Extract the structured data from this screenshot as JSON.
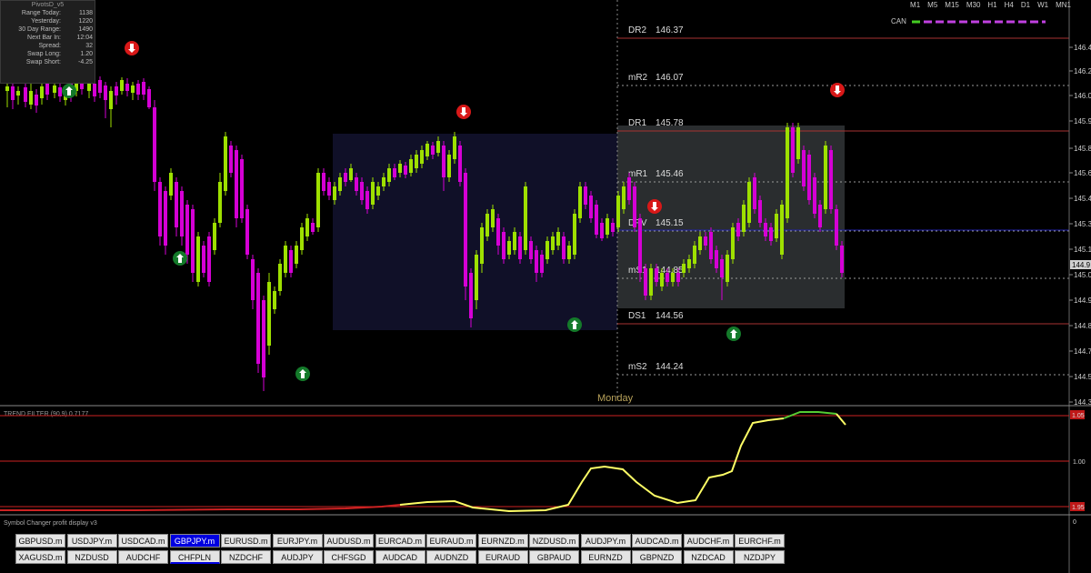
{
  "info_panel": {
    "title": "PivotsD_v5",
    "rows": [
      {
        "label": "Range  Today:",
        "value": "1138"
      },
      {
        "label": "Yesterday:",
        "value": "1220"
      },
      {
        "label": "30 Day Range:",
        "value": "1490"
      },
      {
        "label": "Next Bar In:",
        "value": "12:04"
      },
      {
        "label": "Spread:",
        "value": "32"
      },
      {
        "label": "Swap  Long:",
        "value": "1.20"
      },
      {
        "label": "Swap  Short:",
        "value": "-4.25"
      }
    ]
  },
  "timeframes": [
    "M1",
    "M5",
    "M15",
    "M30",
    "H1",
    "H4",
    "D1",
    "W1",
    "MN1"
  ],
  "legend_label": "CAN",
  "day_label": "Monday",
  "pivots": [
    {
      "name": "DR2",
      "value": "146.37",
      "price": 146.37
    },
    {
      "name": "mR2",
      "value": "146.07",
      "price": 146.07
    },
    {
      "name": "DR1",
      "value": "145.78",
      "price": 145.78
    },
    {
      "name": "mR1",
      "value": "145.46",
      "price": 145.46
    },
    {
      "name": "DPV",
      "value": "145.15",
      "price": 145.15
    },
    {
      "name": "mS1",
      "value": "144.85",
      "price": 144.85
    },
    {
      "name": "DS1",
      "value": "144.56",
      "price": 144.56
    },
    {
      "name": "mS2",
      "value": "144.24",
      "price": 144.24
    }
  ],
  "price_axis": [
    "146.4",
    "146.2",
    "146.0",
    "145.9",
    "145.8",
    "145.6",
    "145.4",
    "145.3",
    "145.1",
    "145.0",
    "144.9",
    "144.8",
    "144.7",
    "144.5",
    "144.3",
    "144.2",
    "144.0"
  ],
  "current_price": "144.9",
  "indicator": {
    "title": "TREND FILTER (90,9) 0.7177",
    "axis": [
      "1.05",
      "1.00",
      "1.95"
    ],
    "bottom_label": "0"
  },
  "symbol_changer": {
    "title": "Symbol Changer profit display v3",
    "row1": [
      "GBPUSD.m",
      "USDJPY.m",
      "USDCAD.m",
      "GBPJPY.m",
      "EURUSD.m",
      "EURJPY.m",
      "AUDUSD.m",
      "EURCAD.m",
      "EURAUD.m",
      "EURNZD.m",
      "NZDUSD.m",
      "AUDJPY.m",
      "AUDCAD.m",
      "AUDCHF.m",
      "EURCHF.m"
    ],
    "row2": [
      "XAGUSD.m",
      "NZDUSD",
      "AUDCHF",
      "CHFPLN",
      "NZDCHF",
      "AUDJPY",
      "CHFSGD",
      "AUDCAD",
      "AUDNZD",
      "EURAUD",
      "GBPAUD",
      "EURNZD",
      "GBPNZD",
      "NZDCAD",
      "NZDJPY"
    ],
    "active": "GBPJPY.m"
  },
  "colors": {
    "bull": "#9ee000",
    "bear": "#d500d5",
    "pivot_line": "#a83232",
    "pivot_dashed": "#9a9a9a",
    "box_left": "#101028",
    "box_right": "#2a2d2f",
    "trend_green": "#55cc33",
    "trend_yellow": "#ffff66",
    "trend_red": "#cc2222",
    "legend_green": "#44cc22",
    "legend_magenta": "#c040e0"
  }
}
